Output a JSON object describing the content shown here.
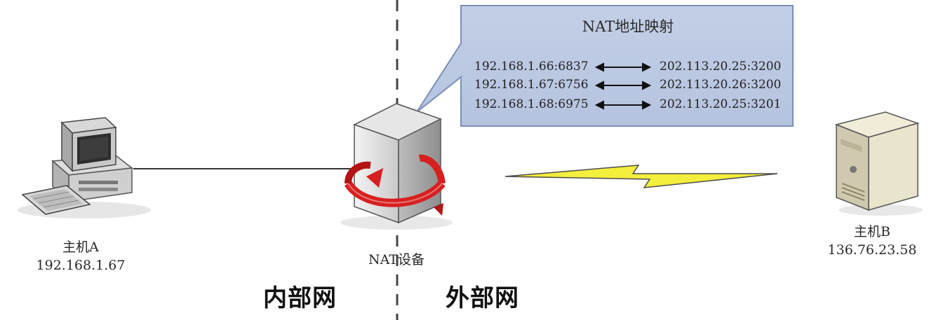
{
  "nat_mapping": {
    "title": "NAT地址映射",
    "rows": [
      {
        "internal": "192.168.1.66:6837",
        "external": "202.113.20.25:3200"
      },
      {
        "internal": "192.168.1.67:6756",
        "external": "202.113.20.26:3200"
      },
      {
        "internal": "192.168.1.68:6975",
        "external": "202.113.20.25:3201"
      }
    ]
  },
  "host_a": {
    "name": "主机A",
    "ip": "192.168.1.67"
  },
  "nat_device": {
    "name": "NAT设备"
  },
  "host_b": {
    "name": "主机B",
    "ip": "136.76.23.58"
  },
  "zones": {
    "internal": "内部网",
    "external": "外部网"
  },
  "icons": {
    "host_a": "desktop-computer-icon",
    "nat_device": "nat-server-icon",
    "host_b": "server-tower-icon",
    "link": "lightning-link-icon"
  }
}
